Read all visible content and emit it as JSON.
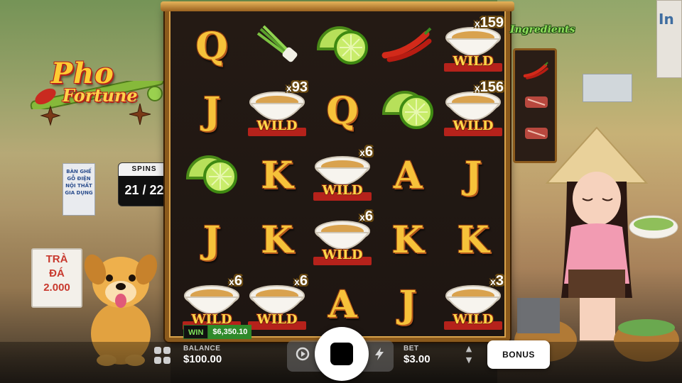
{
  "game": {
    "logo_line1": "Pho",
    "logo_line2": "Fortune"
  },
  "spins": {
    "label": "SPINS",
    "value": "21 / 22"
  },
  "ingredients": {
    "title": "Ingredients",
    "items": [
      "chili-icon",
      "beef-icon",
      "beef-icon"
    ]
  },
  "reels": {
    "rows": [
      [
        {
          "type": "letter",
          "symbol": "Q"
        },
        {
          "type": "icon",
          "symbol": "scallion-icon"
        },
        {
          "type": "icon",
          "symbol": "lime-icon"
        },
        {
          "type": "icon",
          "symbol": "chili-icon"
        },
        {
          "type": "wild",
          "label": "WILD",
          "multiplier": "159"
        }
      ],
      [
        {
          "type": "letter",
          "symbol": "J"
        },
        {
          "type": "wild",
          "label": "WILD",
          "multiplier": "93"
        },
        {
          "type": "letter",
          "symbol": "Q"
        },
        {
          "type": "icon",
          "symbol": "lime-icon"
        },
        {
          "type": "wild",
          "label": "WILD",
          "multiplier": "156"
        }
      ],
      [
        {
          "type": "icon",
          "symbol": "lime-icon"
        },
        {
          "type": "letter",
          "symbol": "K"
        },
        {
          "type": "wild",
          "label": "WILD",
          "multiplier": "6"
        },
        {
          "type": "letter",
          "symbol": "A"
        },
        {
          "type": "letter",
          "symbol": "J"
        }
      ],
      [
        {
          "type": "letter",
          "symbol": "J"
        },
        {
          "type": "letter",
          "symbol": "K"
        },
        {
          "type": "wild",
          "label": "WILD",
          "multiplier": "6"
        },
        {
          "type": "letter",
          "symbol": "K"
        },
        {
          "type": "letter",
          "symbol": "K"
        }
      ],
      [
        {
          "type": "wild",
          "label": "WILD",
          "multiplier": "6"
        },
        {
          "type": "wild",
          "label": "WILD",
          "multiplier": "6"
        },
        {
          "type": "letter",
          "symbol": "A"
        },
        {
          "type": "letter",
          "symbol": "J"
        },
        {
          "type": "wild",
          "label": "WILD",
          "multiplier": "3"
        }
      ]
    ]
  },
  "win": {
    "label": "WIN",
    "value": "$6,350.10"
  },
  "balance": {
    "label": "BALANCE",
    "value": "$100.00"
  },
  "bet": {
    "label": "BET",
    "value": "$3.00"
  },
  "bonus_button": "BONUS",
  "background_signs": {
    "shop_line1": "TRÀ",
    "shop_line2": "ĐÁ",
    "shop_line3": "2.000",
    "store_line1": "BÀN GHẾ",
    "store_line2": "GỖ ĐIỆN",
    "store_line3": "NỘI THẤT",
    "store_line4": "GIA DỤNG",
    "right_sign": "In"
  },
  "colors": {
    "letter_gold": "#f6c23a",
    "wild_red": "#b5221b",
    "win_green": "#2f8a2a",
    "frame_brown": "#8b5a1c"
  }
}
